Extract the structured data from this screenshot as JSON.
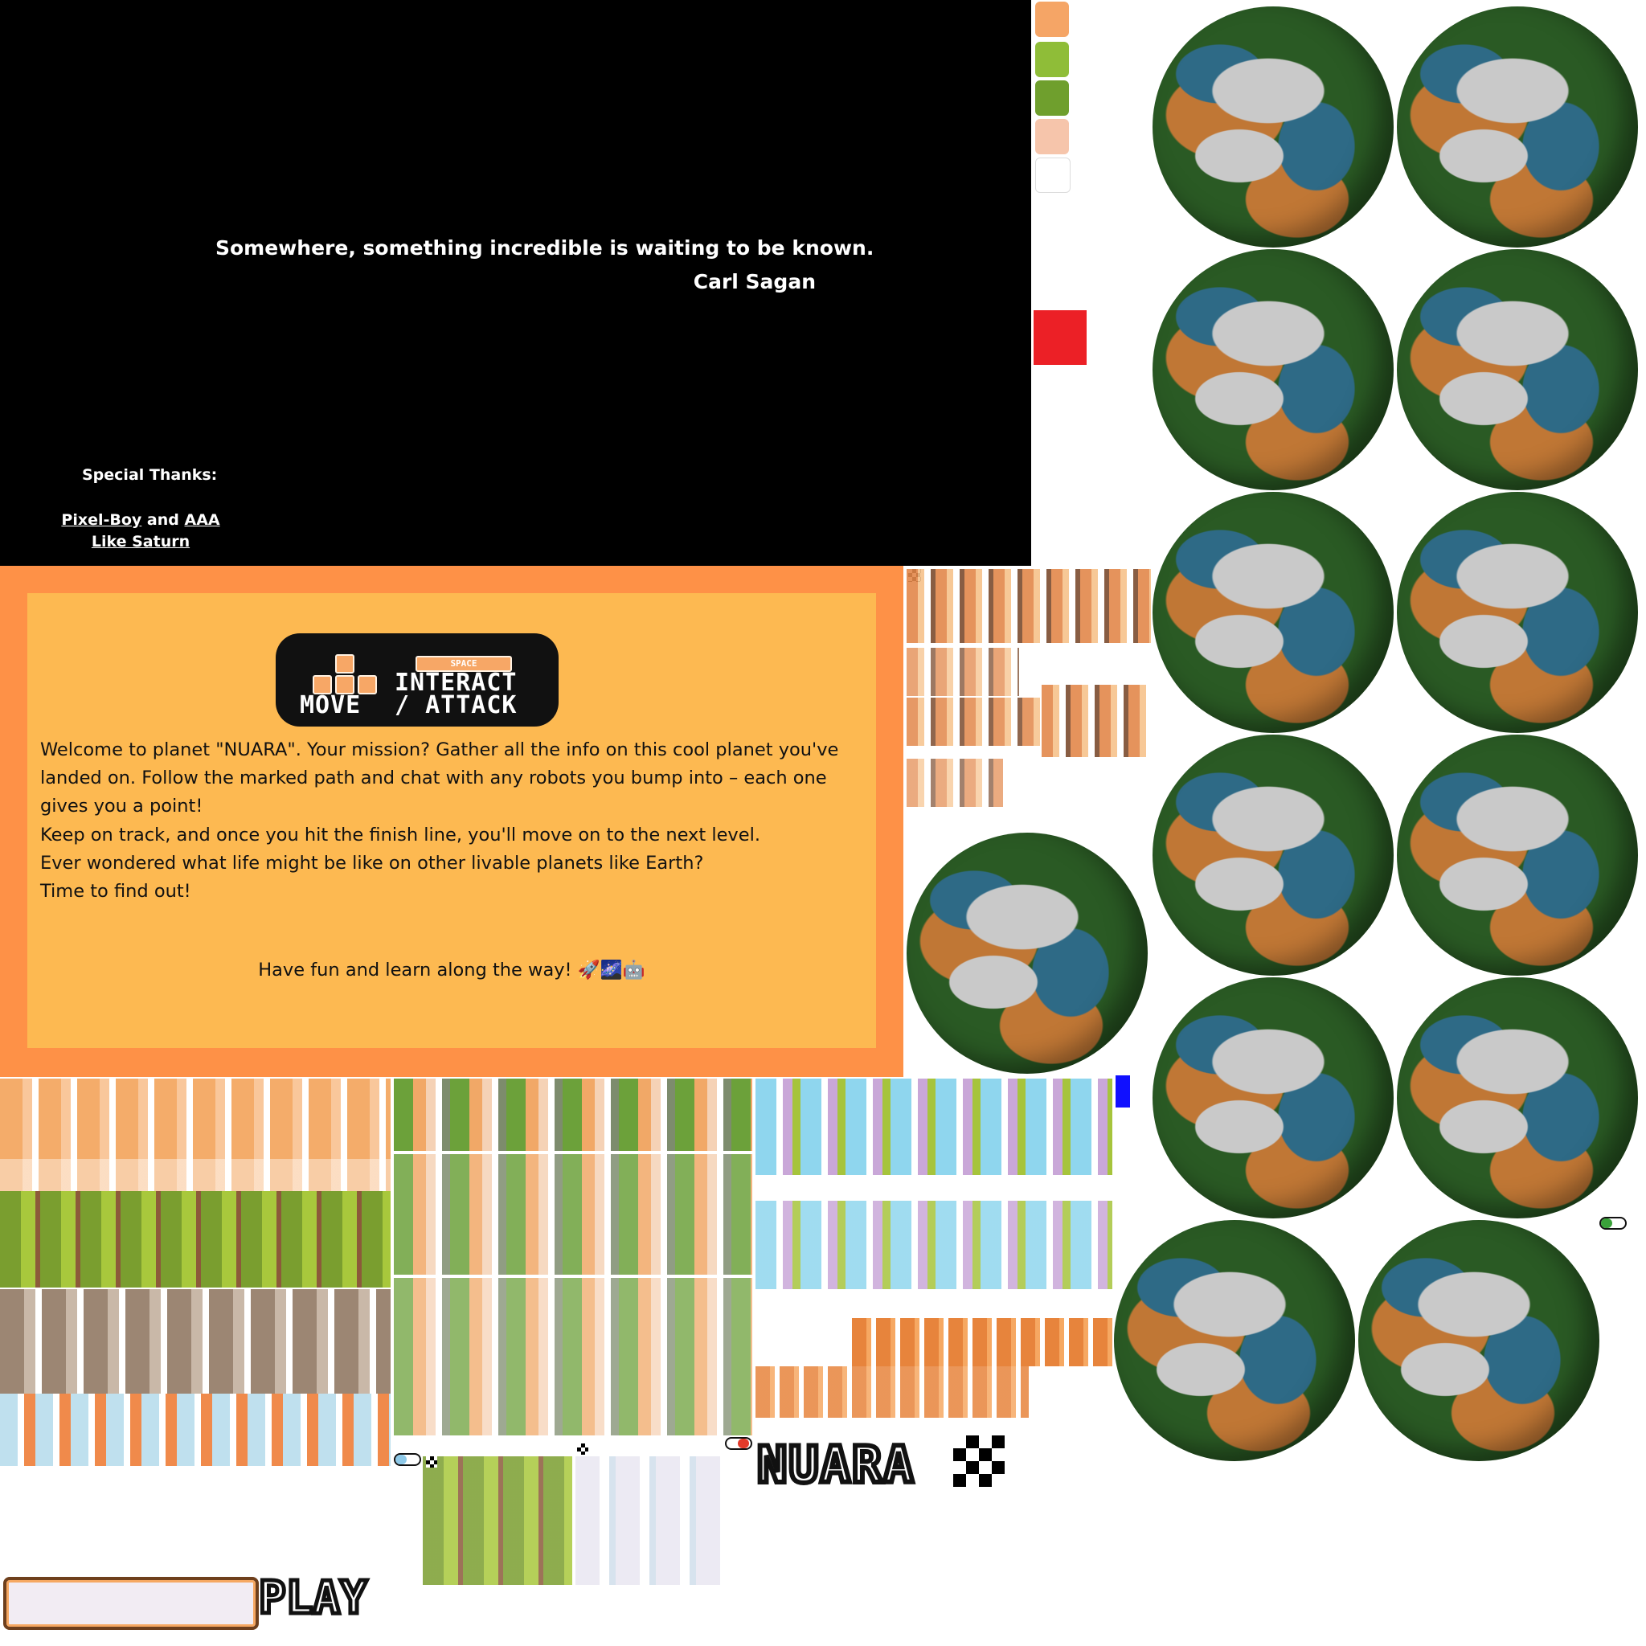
{
  "quote": {
    "text": "Somewhere, something incredible is waiting to be known.",
    "author": "Carl Sagan"
  },
  "thanks": {
    "title": "Special Thanks:",
    "link1": "Pixel-Boy",
    "and": " and ",
    "link2": "AAA",
    "link3": "Like Saturn"
  },
  "controls": {
    "space_label": "SPACE",
    "move_label": "MOVE",
    "interact_label_1": "INTERACT",
    "interact_label_2": "/ ATTACK"
  },
  "instructions": {
    "para1": "Welcome to planet \"NUARA\". Your mission? Gather all the info on this cool planet you've landed on. Follow the marked path and chat with any robots you bump into – each one gives you a point!",
    "para2_line1": "Keep on track, and once you hit the finish line, you'll move on to the next level.",
    "para2_line2": "Ever wondered what life might be like on other livable planets like Earth?",
    "para2_line3": "Time to find out!",
    "fun_line": "Have fun and learn along the way! 🚀🌌🤖"
  },
  "logos": {
    "nuara": "NUARA",
    "play": "PLAY"
  },
  "colors": {
    "quote_bg": "#000000",
    "panel_outer": "#fe9147",
    "panel_inner": "#fdb951",
    "planet_green": "#2a5a24",
    "planet_orange": "#c07735",
    "planet_blue": "#2e6a86",
    "planet_grey": "#c9c9c9",
    "red_swatch": "#ec2026",
    "blue_swatch": "#1010ff"
  }
}
